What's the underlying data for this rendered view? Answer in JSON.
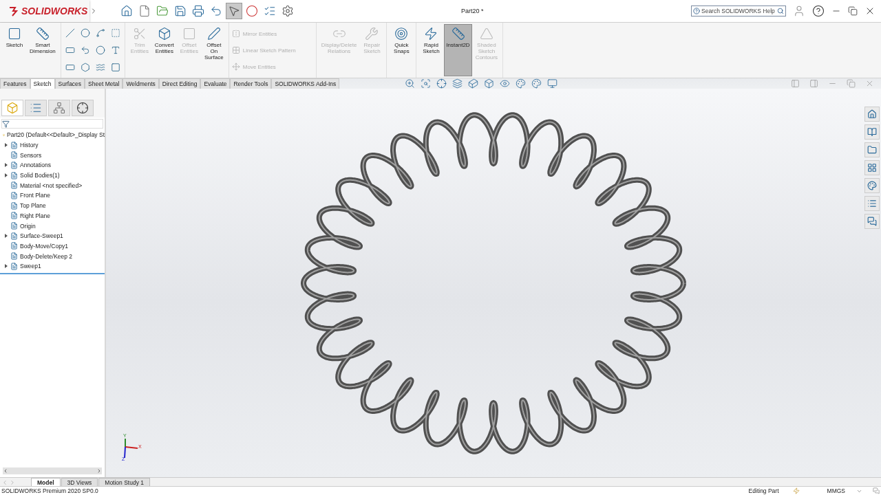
{
  "title_bar": {
    "logo_text": "SOLIDWORKS",
    "document_title": "Part20 *",
    "search": {
      "placeholder": "Search SOLIDWORKS Help"
    }
  },
  "ribbon_groups": [
    {
      "kind": "commands",
      "commands": [
        {
          "label": "Sketch",
          "disabled": false,
          "active": false
        },
        {
          "label": "Smart Dimension",
          "disabled": false,
          "active": false
        }
      ]
    },
    {
      "kind": "tools"
    },
    {
      "kind": "commands",
      "commands": [
        {
          "label": "Trim Entities",
          "disabled": true,
          "active": false
        },
        {
          "label": "Convert Entities",
          "disabled": false,
          "active": false
        },
        {
          "label": "Offset Entities",
          "disabled": true,
          "active": false
        },
        {
          "label": "Offset On Surface",
          "disabled": false,
          "active": false
        }
      ]
    },
    {
      "kind": "small_list",
      "commands": [
        {
          "label": "Mirror Entities",
          "disabled": true
        },
        {
          "label": "Linear Sketch Pattern",
          "disabled": true
        },
        {
          "label": "Move Entities",
          "disabled": true
        }
      ]
    },
    {
      "kind": "commands",
      "commands": [
        {
          "label": "Display/Delete Relations",
          "disabled": true,
          "active": false
        },
        {
          "label": "Repair Sketch",
          "disabled": true,
          "active": false
        }
      ]
    },
    {
      "kind": "commands",
      "commands": [
        {
          "label": "Quick Snaps",
          "disabled": false,
          "active": false
        }
      ]
    },
    {
      "kind": "commands",
      "commands": [
        {
          "label": "Rapid Sketch",
          "disabled": false,
          "active": false
        },
        {
          "label": "Instant2D",
          "disabled": false,
          "active": true
        },
        {
          "label": "Shaded Sketch Contours",
          "disabled": true,
          "active": false
        }
      ]
    }
  ],
  "command_tabs": [
    {
      "label": "Features",
      "selected": false
    },
    {
      "label": "Sketch",
      "selected": true
    },
    {
      "label": "Surfaces",
      "selected": false
    },
    {
      "label": "Sheet Metal",
      "selected": false
    },
    {
      "label": "Weldments",
      "selected": false
    },
    {
      "label": "Direct Editing",
      "selected": false
    },
    {
      "label": "Evaluate",
      "selected": false
    },
    {
      "label": "Render Tools",
      "selected": false
    },
    {
      "label": "SOLIDWORKS Add-Ins",
      "selected": false
    }
  ],
  "feature_tree": {
    "root": "Part20  (Default<<Default>_Display St",
    "items": [
      {
        "label": "History",
        "expandable": true
      },
      {
        "label": "Sensors",
        "expandable": false
      },
      {
        "label": "Annotations",
        "expandable": true
      },
      {
        "label": "Solid Bodies(1)",
        "expandable": true
      },
      {
        "label": "Material <not specified>",
        "expandable": false
      },
      {
        "label": "Front Plane",
        "expandable": false
      },
      {
        "label": "Top Plane",
        "expandable": false
      },
      {
        "label": "Right Plane",
        "expandable": false
      },
      {
        "label": "Origin",
        "expandable": false
      },
      {
        "label": "Surface-Sweep1",
        "expandable": true
      },
      {
        "label": "Body-Move/Copy1",
        "expandable": false
      },
      {
        "label": "Body-Delete/Keep 2",
        "expandable": false
      },
      {
        "label": "Sweep1",
        "expandable": true
      }
    ]
  },
  "triad": {
    "x": "X",
    "y": "Y",
    "z": "Z"
  },
  "bottom_tabs": [
    {
      "label": "Model",
      "selected": true
    },
    {
      "label": "3D Views",
      "selected": false
    },
    {
      "label": "Motion Study 1",
      "selected": false
    }
  ],
  "status_bar": {
    "product": "SOLIDWORKS Premium 2020 SP0.0",
    "mode": "Editing Part",
    "units": "MMGS"
  }
}
